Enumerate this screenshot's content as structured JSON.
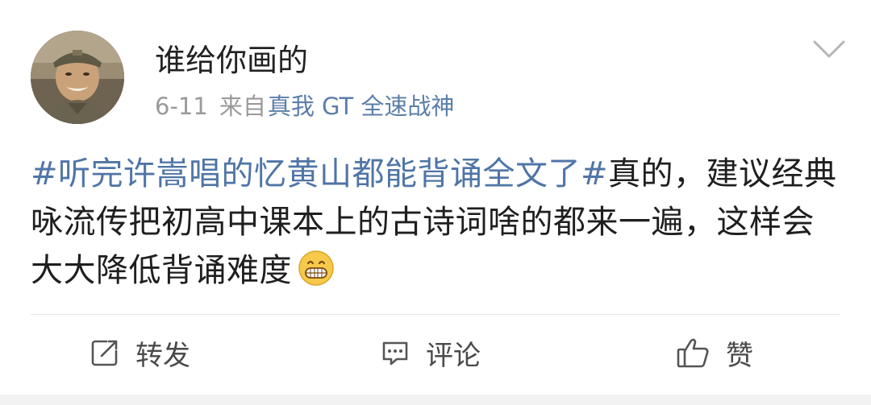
{
  "post": {
    "username": "谁给你画的",
    "date": "6-11",
    "source_prefix": "来自",
    "device": "真我 GT 全速战神",
    "content": {
      "topic": "#听完许嵩唱的忆黄山都能背诵全文了#",
      "text": "真的，建议经典咏流传把初高中课本上的古诗词啥的都来一遍，这样会大大降低背诵难度"
    },
    "emoji_icon": "grinning-face-emoji"
  },
  "actions": {
    "repost": {
      "label": "转发",
      "icon": "repost-icon"
    },
    "comment": {
      "label": "评论",
      "icon": "comment-icon"
    },
    "like": {
      "label": "赞",
      "icon": "thumbs-up-icon"
    }
  },
  "colors": {
    "topic": "#4f75a6",
    "meta": "#9a9a9a",
    "device": "#5b7ea8",
    "action_text": "#4a4a4a"
  }
}
